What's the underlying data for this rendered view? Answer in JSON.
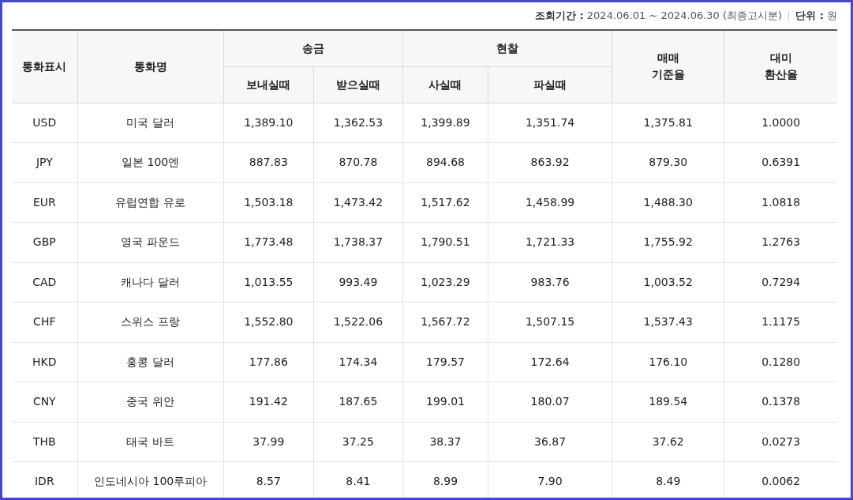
{
  "info": {
    "period": "**조회기간 :** 2024.06.01 ~ 2024.06.30 (최종고시분)",
    "unit": "**단위 :** 원"
  },
  "table": {
    "header_rows": [
      [
        {
          "label": "통화표시",
          "rowspan": 2
        },
        {
          "label": "통화명",
          "rowspan": 2
        },
        {
          "label": "송금",
          "colspan": 2
        },
        {
          "label": "현찰",
          "colspan": 2
        },
        {
          "label": "매매\n기준율",
          "rowspan": 2
        },
        {
          "label": "대미\n환산율",
          "rowspan": 2
        }
      ],
      [
        {
          "label": "보내실때"
        },
        {
          "label": "받으실때"
        },
        {
          "label": "사실때"
        },
        {
          "label": "파실때"
        }
      ]
    ],
    "rows": [
      [
        "USD",
        "미국 달러",
        "1,389.10",
        "1,362.53",
        "1,399.89",
        "1,351.74",
        "1,375.81",
        "1.0000"
      ],
      [
        "JPY",
        "일본 100엔",
        "887.83",
        "870.78",
        "894.68",
        "863.92",
        "879.30",
        "0.6391"
      ],
      [
        "EUR",
        "유럽연합 유로",
        "1,503.18",
        "1,473.42",
        "1,517.62",
        "1,458.99",
        "1,488.30",
        "1.0818"
      ],
      [
        "GBP",
        "영국 파운드",
        "1,773.48",
        "1,738.37",
        "1,790.51",
        "1,721.33",
        "1,755.92",
        "1.2763"
      ],
      [
        "CAD",
        "캐나다 달러",
        "1,013.55",
        "993.49",
        "1,023.29",
        "983.76",
        "1,003.52",
        "0.7294"
      ],
      [
        "CHF",
        "스위스 프랑",
        "1,552.80",
        "1,522.06",
        "1,567.72",
        "1,507.15",
        "1,537.43",
        "1.1175"
      ],
      [
        "HKD",
        "홍콩 달러",
        "177.86",
        "174.34",
        "179.57",
        "172.64",
        "176.10",
        "0.1280"
      ],
      [
        "CNY",
        "중국 위안",
        "191.42",
        "187.65",
        "199.01",
        "180.07",
        "189.54",
        "0.1378"
      ],
      [
        "THB",
        "태국 바트",
        "37.99",
        "37.25",
        "38.37",
        "36.87",
        "37.62",
        "0.0273"
      ],
      [
        "IDR",
        "인도네시아 100루피아",
        "8.57",
        "8.41",
        "8.99",
        "7.90",
        "8.49",
        "0.0062"
      ]
    ]
  }
}
